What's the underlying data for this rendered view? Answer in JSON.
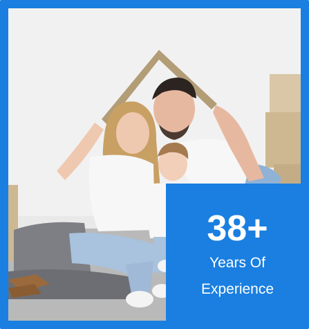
{
  "image": {
    "description_icon": "family-house-photo-icon"
  },
  "badge": {
    "number": "38+",
    "line1": "Years Of",
    "line2": "Experience"
  },
  "colors": {
    "accent": "#1a7fe0",
    "badge_text": "#ffffff"
  }
}
